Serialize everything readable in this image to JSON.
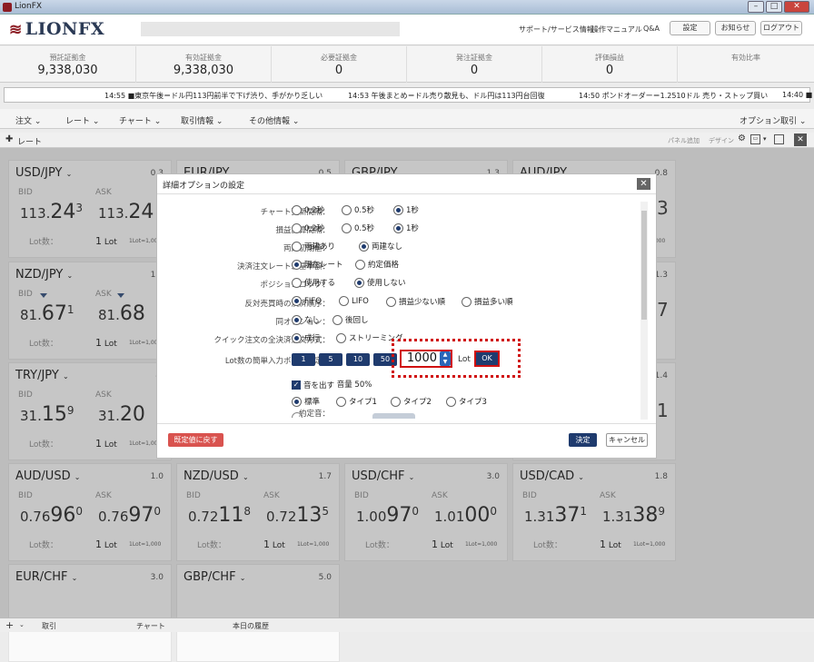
{
  "window": {
    "title": "LionFX"
  },
  "header": {
    "logo": "LIONFX",
    "links": [
      "サポート/サービス情報",
      "操作マニュアル",
      "Q&A"
    ],
    "buttons": [
      "設定",
      "お知らせ",
      "ログアウト"
    ]
  },
  "summary": [
    {
      "label": "預託証拠金",
      "value": "9,338,030"
    },
    {
      "label": "有効証拠金",
      "value": "9,338,030"
    },
    {
      "label": "必要証拠金",
      "value": "0"
    },
    {
      "label": "発注証拠金",
      "value": "0"
    },
    {
      "label": "評価損益",
      "value": "0"
    },
    {
      "label": "有効比率",
      "value": ""
    }
  ],
  "ticker": [
    {
      "time": "14:55",
      "text": "■東京午後＝ドル円113円前半で下げ渋り、手がかり乏しい"
    },
    {
      "time": "14:53",
      "text": "午後まとめ＝ドル売り散見も、ドル円は113円台回復"
    },
    {
      "time": "14:50",
      "text": "ポンドオーダー＝1.2510ドル 売り・ストップ買い"
    },
    {
      "time": "14:40",
      "text": "■"
    }
  ],
  "menu": {
    "items": [
      "注文",
      "レート",
      "チャート",
      "取引情報",
      "その他情報"
    ],
    "right": "オプション取引"
  },
  "panel": {
    "title": "レート",
    "add": "パネル追加",
    "design": "デザイン"
  },
  "card_labels": {
    "bid": "BID",
    "ask": "ASK",
    "lot": "Lot数：",
    "lot_unit": "Lot",
    "lot_size": "1Lot=1,000"
  },
  "cards": [
    {
      "pair": "USD/JPY",
      "spread": "0.3",
      "bid": [
        "113.",
        "24",
        "3"
      ],
      "ask": [
        "113.",
        "24",
        ""
      ],
      "lot": "1"
    },
    {
      "pair": "EUR/JPY",
      "spread": "0.5",
      "bid": [
        "",
        "",
        ""
      ],
      "ask": [
        "",
        "",
        ""
      ],
      "lot": ""
    },
    {
      "pair": "GBP/JPY",
      "spread": "1.3",
      "bid": [
        "",
        "",
        ""
      ],
      "ask": [
        "",
        "",
        ""
      ],
      "lot": ""
    },
    {
      "pair": "AUD/JPY",
      "spread": "0.8",
      "bid": [
        "",
        "",
        ""
      ],
      "ask": [
        "",
        "",
        "3"
      ],
      "lot": ""
    },
    {
      "pair": "NZD/JPY",
      "spread": "1.3",
      "bid": [
        "81.",
        "67",
        "1"
      ],
      "ask": [
        "81.",
        "68",
        ""
      ],
      "lot": "1"
    },
    {
      "pair": "TRY/JPY",
      "spread": "4.",
      "bid": [
        "31.",
        "15",
        "9"
      ],
      "ask": [
        "31.",
        "20",
        ""
      ],
      "lot": "1"
    },
    {
      "pair": "AUD/USD",
      "spread": "1.0",
      "bid": [
        "0.76",
        "96",
        "0"
      ],
      "ask": [
        "0.76",
        "97",
        "0"
      ],
      "lot": "1"
    },
    {
      "pair": "NZD/USD",
      "spread": "1.7",
      "bid": [
        "0.72",
        "11",
        "8"
      ],
      "ask": [
        "0.72",
        "13",
        "5"
      ],
      "lot": "1"
    },
    {
      "pair": "USD/CHF",
      "spread": "3.0",
      "bid": [
        "1.00",
        "97",
        "0"
      ],
      "ask": [
        "1.01",
        "00",
        "0"
      ],
      "lot": "1"
    },
    {
      "pair": "USD/CAD",
      "spread": "1.8",
      "bid": [
        "1.31",
        "37",
        "1"
      ],
      "ask": [
        "1.31",
        "38",
        "9"
      ],
      "lot": "1"
    },
    {
      "pair": "EUR/CHF",
      "spread": "3.0"
    },
    {
      "pair": "GBP/CHF",
      "spread": "5.0"
    }
  ],
  "right_partial": {
    "r1": "3",
    "r2": "7",
    "r3": "1",
    "r2s": "1.3",
    "r3s": "1.4"
  },
  "dialog": {
    "title": "詳細オプションの設定",
    "rows": [
      {
        "label": "チャート更新間隔：",
        "options": [
          "0.2秒",
          "0.5秒",
          "1秒"
        ],
        "selected": 2
      },
      {
        "label": "損益計算間隔：",
        "options": [
          "0.2秒",
          "0.5秒",
          "1秒"
        ],
        "selected": 2
      },
      {
        "label": "両建初期値：",
        "options": [
          "両建あり",
          "両建なし"
        ],
        "selected": 1
      },
      {
        "label": "決済注文レート差基準額：",
        "options": [
          "現在レート",
          "約定価格"
        ],
        "selected": 0
      },
      {
        "label": "ポジションロック：",
        "options": [
          "使用する",
          "使用しない"
        ],
        "selected": 1
      },
      {
        "label": "反対売買時の決済順序：",
        "options": [
          "FIFO",
          "LIFO",
          "損益少ない順",
          "損益多い順"
        ],
        "selected": 0
      },
      {
        "label": "同オプション：",
        "options": [
          "なし",
          "後回し"
        ],
        "selected": 0
      },
      {
        "label": "クイック注文の全決済注文方式：",
        "options": [
          "成行",
          "ストリーミング"
        ],
        "selected": 0
      }
    ],
    "lot_label": "Lot数の簡単入力ボタン設定：",
    "lot_buttons": [
      "1",
      "5",
      "10",
      "50"
    ],
    "lot_input": "1000",
    "lot_unit": "Lot",
    "ok": "OK",
    "sound_check": "音を出す",
    "volume": "音量 50%",
    "sound_label": "約定音：",
    "sound_options": [
      "標準",
      "タイプ1",
      "タイプ2",
      "タイプ3"
    ],
    "sound_selected": 0,
    "reset": "既定値に戻す",
    "confirm": "決定",
    "cancel": "キャンセル"
  },
  "statusbar": [
    "取引",
    "チャート",
    "本日の履歴"
  ]
}
